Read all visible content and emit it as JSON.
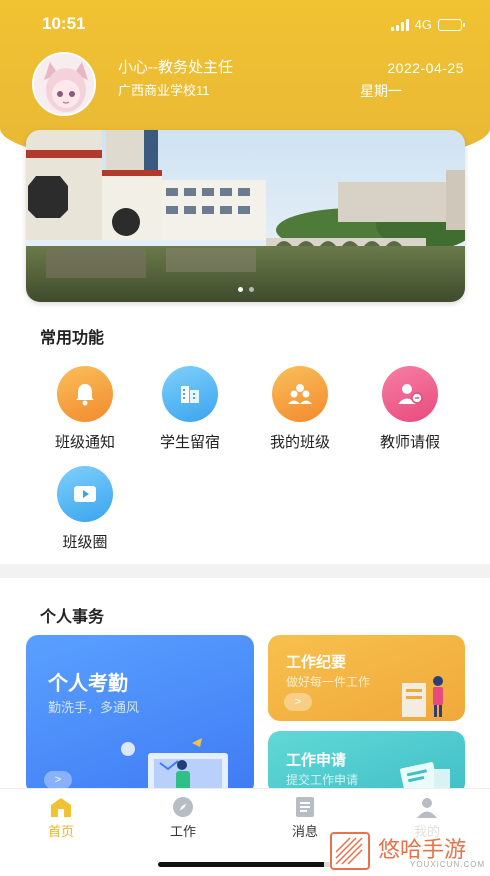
{
  "status_bar": {
    "time": "10:51",
    "network": "4G"
  },
  "user": {
    "name": "小心--教务处主任",
    "school": "广西商业学校11",
    "date": "2022-04-25",
    "weekday": "星期一"
  },
  "common_functions": {
    "title": "常用功能",
    "items": [
      {
        "label": "班级通知",
        "icon": "bell-icon",
        "color": "#f5a623"
      },
      {
        "label": "学生留宿",
        "icon": "building-icon",
        "color": "#4fb3f5"
      },
      {
        "label": "我的班级",
        "icon": "group-icon",
        "color": "#f5a623"
      },
      {
        "label": "教师请假",
        "icon": "person-leave-icon",
        "color": "#f0598a"
      },
      {
        "label": "班级圈",
        "icon": "video-icon",
        "color": "#4fb3f5"
      }
    ]
  },
  "personal_affairs": {
    "title": "个人事务",
    "cards": [
      {
        "title": "个人考勤",
        "subtitle": "勤洗手，多通风"
      },
      {
        "title": "工作纪要",
        "subtitle": "做好每一件工作"
      },
      {
        "title": "工作申请",
        "subtitle": "提交工作申请"
      }
    ]
  },
  "tabbar": [
    {
      "label": "首页",
      "icon": "home-icon",
      "active": true
    },
    {
      "label": "工作",
      "icon": "compass-icon",
      "active": false
    },
    {
      "label": "消息",
      "icon": "message-icon",
      "active": false
    },
    {
      "label": "我的",
      "icon": "user-icon",
      "active": false
    }
  ],
  "watermark": {
    "text": "悠哈手游",
    "sub": "YOUXICUN.COM"
  },
  "colors": {
    "accent": "#e9b32c",
    "header": "#f1c232"
  }
}
